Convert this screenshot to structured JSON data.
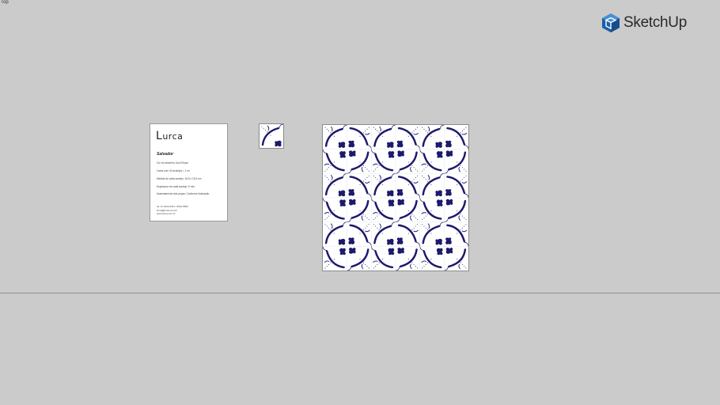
{
  "viewport": {
    "view_name": "Top"
  },
  "branding": {
    "app_name": "SketchUp",
    "logo_icon": "sketchup-logo-icon",
    "accent_color": "#1b5fa8"
  },
  "product_card": {
    "brand_first": "L",
    "brand_rest": "urca",
    "title": "Salvador",
    "lines": [
      "Cor do desenho: Azul Royal",
      "Caixa com 40 azulejos = 1 m²",
      "Medida de cada azulejo: 15,5 x 15,5 cm",
      "Espessura de cada azulejo: 5 mm",
      "Assentamento das peças: Conforme Ilustração"
    ],
    "contact": [
      "tel: 11 3412-0212 | 9601-8842",
      "lurca@lurca.com.br",
      "www.lurca.com.br"
    ]
  },
  "tile": {
    "ink_color": "#1c1a6b",
    "grid_repeat": 6
  }
}
